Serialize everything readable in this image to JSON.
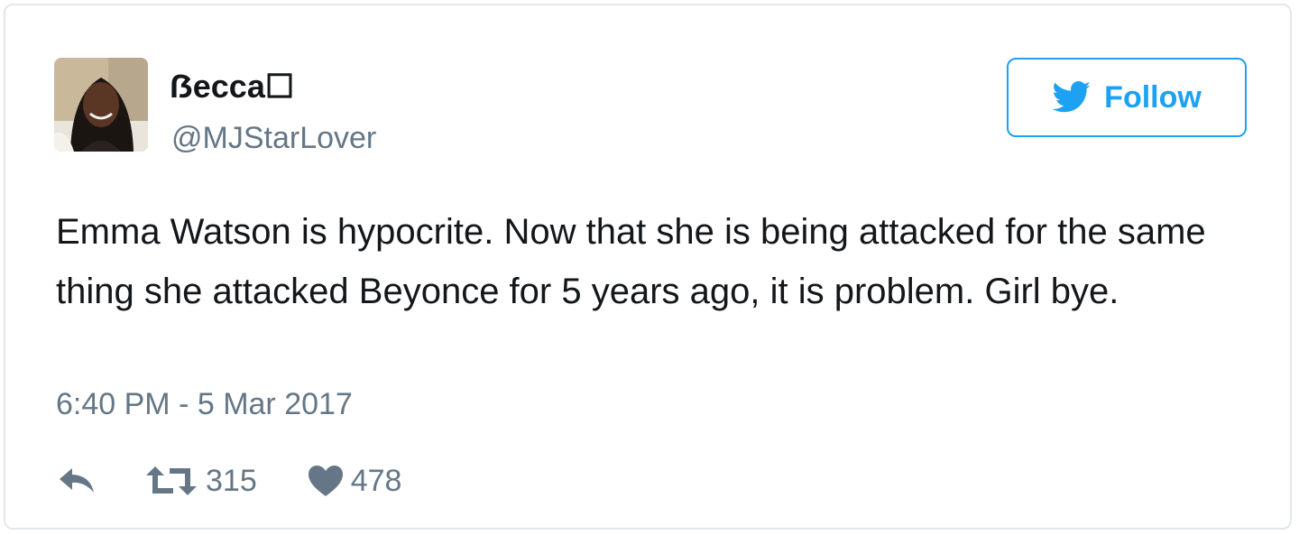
{
  "tweet": {
    "display_name": "ẞecca☐",
    "handle": "@MJStarLover",
    "follow_label": "Follow",
    "text": "Emma Watson is hypocrite. Now that she is being attacked for the same thing she attacked Beyonce for 5 years ago, it is problem. Girl bye.",
    "timestamp": "6:40 PM - 5 Mar 2017",
    "retweet_count": "315",
    "like_count": "478"
  },
  "icons": {
    "follow": "twitter-bird-icon",
    "reply": "reply-icon",
    "retweet": "retweet-icon",
    "like": "heart-icon"
  },
  "colors": {
    "accent": "#1da1f2",
    "text": "#14171a",
    "secondary": "#657786",
    "border": "#e1e8ed"
  }
}
